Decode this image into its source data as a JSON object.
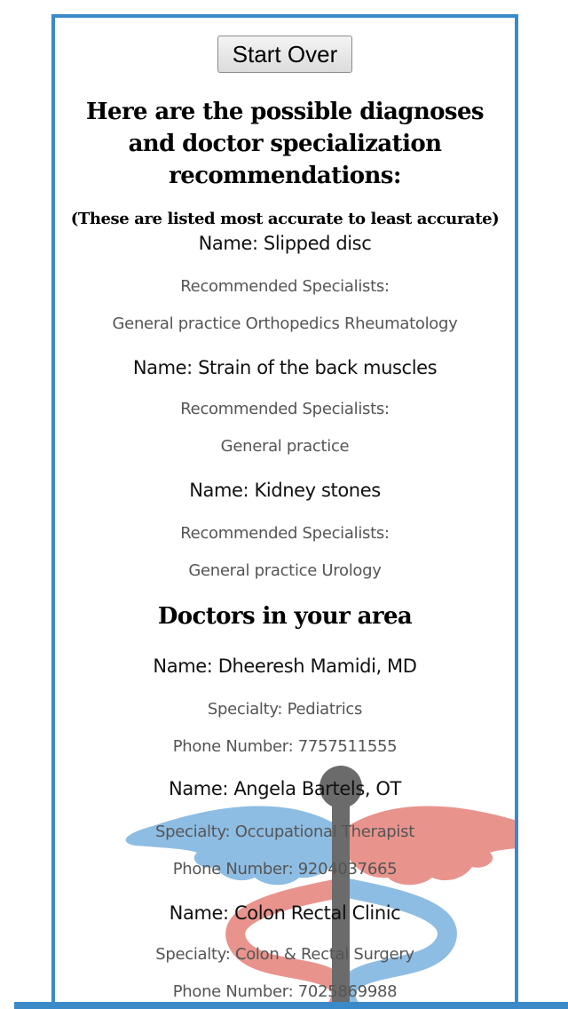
{
  "controls": {
    "start_over_label": "Start Over"
  },
  "results": {
    "heading": "Here are the possible diagnoses and doctor specialization recommendations:",
    "subheading": "(These are listed most accurate to least accurate)",
    "specialists_label": "Recommended Specialists:",
    "diagnoses": [
      {
        "name": "Name: Slipped disc",
        "specialists": "General practice Orthopedics Rheumatology"
      },
      {
        "name": "Name: Strain of the back muscles",
        "specialists": "General practice"
      },
      {
        "name": "Name: Kidney stones",
        "specialists": "General practice Urology"
      }
    ]
  },
  "doctors": {
    "title": "Doctors in your area",
    "list": [
      {
        "name": "Name: Dheeresh Mamidi, MD",
        "specialty": "Specialty: Pediatrics",
        "phone": "Phone Number: 7757511555"
      },
      {
        "name": "Name: Angela Bartels, OT",
        "specialty": "Specialty: Occupational Therapist",
        "phone": "Phone Number: 9204037665"
      },
      {
        "name": "Name: Colon Rectal Clinic",
        "specialty": "Specialty: Colon & Rectal Surgery",
        "phone": "Phone Number: 7025869988"
      }
    ]
  },
  "colors": {
    "frame": "#3a8ac9",
    "wing_blue": "#8ebde3",
    "wing_red": "#e8948d",
    "staff": "#6b6b6b"
  }
}
